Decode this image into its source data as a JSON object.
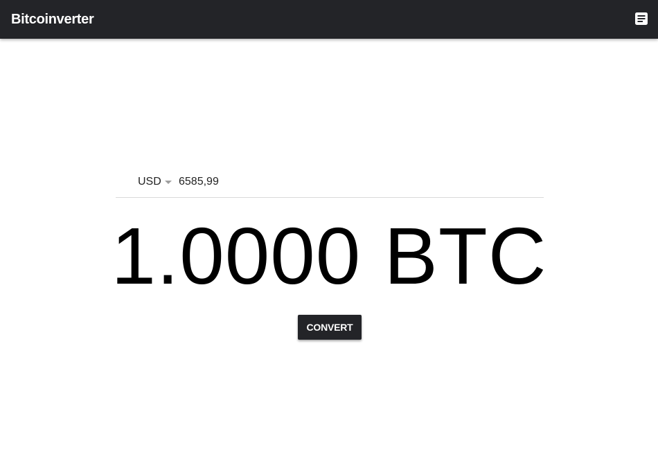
{
  "app": {
    "title": "Bitcoinverter",
    "menu_icon": "list-alt-icon"
  },
  "colors": {
    "appbar": "#232428",
    "button": "#232428",
    "button_text": "#ffffff",
    "background": "#ffffff"
  },
  "converter": {
    "currency": {
      "selected": "USD",
      "icon": "dropdown-arrow-icon"
    },
    "amount": {
      "value": "6585,99"
    },
    "result": "1.0000 BTC",
    "convert_label": "CONVERT"
  }
}
